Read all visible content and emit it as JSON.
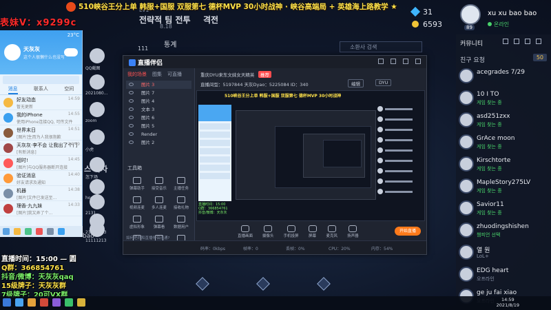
{
  "marquee": {
    "text": "510峡谷王分上单 韩服+国服 双服第七 德杯MVP 30小时战神 · 峡谷高端局 + 英雄海上路教学 ★",
    "left_overlay": "表妹V：x9299c"
  },
  "game": {
    "tabs": [
      "전략적 팀 전투",
      "격전"
    ],
    "sub_texts": [
      "Lv1",
      "8.18"
    ],
    "nav_labels": [
      "111",
      "통계"
    ],
    "search_placeholder": "소환사 검색"
  },
  "stats": {
    "value1": "31",
    "value2": "6593"
  },
  "profile": {
    "name": "xu xu bao bao",
    "status": "온라인",
    "level": "89"
  },
  "friends": {
    "header": "커뮤니티",
    "requests": "친구 요청",
    "count": "50",
    "list": [
      {
        "name": "acegrades 7/29",
        "status": "",
        "state": "away"
      },
      {
        "name": "10 I TO",
        "status": "게임 찾는 중",
        "state": "on"
      },
      {
        "name": "asd251zxx",
        "status": "게임 찾는 중",
        "state": "on"
      },
      {
        "name": "GrAce moon",
        "status": "게임 찾는 중",
        "state": "on"
      },
      {
        "name": "Kirschtorte",
        "status": "게임 찾는 중",
        "state": "on"
      },
      {
        "name": "MapleStory275LV",
        "status": "게임 찾는 중",
        "state": "on"
      },
      {
        "name": "Savior11",
        "status": "게임 찾는 중",
        "state": "on"
      },
      {
        "name": "zhuodingshishen",
        "status": "챔피언 선택",
        "state": "on"
      },
      {
        "name": "열 원",
        "status": "LoL+",
        "state": "off"
      },
      {
        "name": "EDG heart",
        "status": "오프라인",
        "state": "off"
      },
      {
        "name": "ge ju fai xiao",
        "status": "오프라인",
        "state": "off"
      }
    ]
  },
  "qq": {
    "weather": "23°C",
    "name": "天灰灰",
    "signature": "这个人很懒什么也没写",
    "tabs": [
      "消息",
      "联系人",
      "空间"
    ],
    "items": [
      {
        "title": "好友动态",
        "sub": "暂无更新",
        "time": "14:59",
        "color": "#f5b942"
      },
      {
        "title": "我的iPhone",
        "sub": "使用iPhone连接QQ, 可传文件",
        "time": "14:55",
        "color": "#3aa0f0"
      },
      {
        "title": "世界末日",
        "sub": "[图片]生而为人我很抱歉",
        "time": "14:51",
        "color": "#8a5c3d"
      },
      {
        "title": "天灰灰·李不会 让我出了个门",
        "sub": "[有新消息]",
        "time": "14:49",
        "color": "#a04848"
      },
      {
        "title": "超时!",
        "sub": "[图片]与QQ服务器断开连接",
        "time": "14:45",
        "color": "#ff5a5a"
      },
      {
        "title": "验证消息",
        "sub": "好友请求及通知",
        "time": "14:40",
        "color": "#ff9a3a"
      },
      {
        "title": "机器",
        "sub": "[图片]文件已发送至...",
        "time": "14:38",
        "color": "#7a8fa8"
      },
      {
        "title": "理香·九九妹",
        "sub": "[图片]我又弄了个...",
        "time": "14:33",
        "color": "#c04040"
      }
    ]
  },
  "stream_info": {
    "line1": "直播时间：15:00 — 圆",
    "line2": "Q群：366854761",
    "line3": "抖音/微博：天灰灰qaq",
    "line4": "15级牌子：天灰灰群",
    "line5": "7级牌子：20可VX群"
  },
  "side": {
    "labels": [
      "QQ截图",
      "2021080...",
      "zoom",
      "小虎",
      "怎下场",
      "hoyun",
      "2131",
      "21213123",
      "11111213"
    ],
    "big_text": "스 하자",
    "bao": "bao"
  },
  "obs": {
    "title": "直播伴侣",
    "left_tabs": [
      "我的场景",
      "图集",
      "可直播"
    ],
    "scenes": [
      "图片 3",
      "图片 7",
      "图片 4",
      "文本 3",
      "图片 6",
      "图片 5",
      "Render",
      "图片 2"
    ],
    "tools_header": "工具箱",
    "tools": [
      "弹幕助手",
      "接受音乐",
      "主播任务",
      "视频连麦",
      "多人连麦",
      "接收礼物",
      "虚拟形象",
      "弹幕看",
      "数据用户",
      "连线管理",
      "弹幕姬",
      "更多"
    ],
    "tip": "如何把你和直播伴侣连通?",
    "info_title": "重庆DYU来东文妹女天精英",
    "info_badge": "推荐",
    "info_sub": "直播间型：5197844  天灰Dyao：5225084  ID：340",
    "info_btn1": "编辑",
    "info_btn2": "DYU",
    "preview_title": "510峡谷王分上单 韩服+国服 双服第七 德杯MVP 30小时战神",
    "preview_text": "直播时间：15:00\nQ群：366854761\n抖音/微博：天灰灰",
    "controls": [
      "直播画面",
      "摄像头",
      "手机投屏",
      "屏幕",
      "麦克风",
      "扬声器"
    ],
    "live_btn": "开始直播",
    "status": [
      "码率：0kbps",
      "帧率：0",
      "丢帧：0%",
      "CPU：20%",
      "内存：54%"
    ]
  },
  "taskbar": {
    "time": "14:59",
    "date": "2021/8/19"
  }
}
